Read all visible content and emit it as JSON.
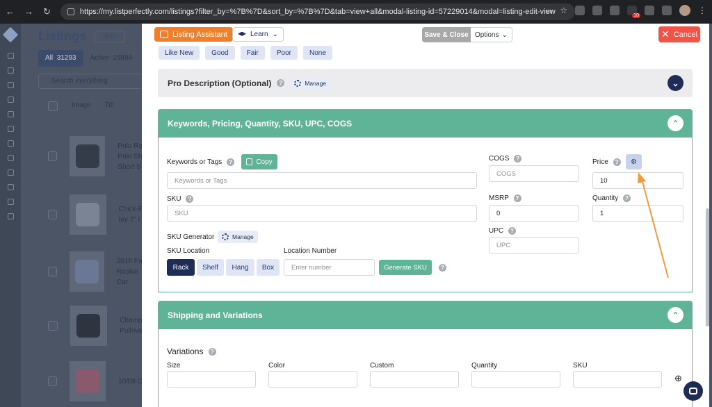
{
  "browser": {
    "url": "https://my.listperfectly.com/listings?filter_by=%7B%7D&sort_by=%7B%7D&tab=view+all&modal-listing-id=57229014&modal=listing-edit-view",
    "extension_badge": "10"
  },
  "background": {
    "title": "Listings",
    "learn_label": "Learn",
    "tabs": [
      {
        "label": "All",
        "count": "31293"
      },
      {
        "label": "Active",
        "count": "29894"
      }
    ],
    "search_placeholder": "Search everything",
    "columns": [
      "Image",
      "Titl"
    ],
    "rows": [
      {
        "title": "Polo Ra\nPolo Sh\nShort S"
      },
      {
        "title": "Chick-F\ntoy 7\" I"
      },
      {
        "title": "2018 Pa\nRookie\nCar"
      },
      {
        "title": "Champ\nPullove"
      },
      {
        "title": "10/09 C"
      }
    ]
  },
  "modal": {
    "assistant_label": "Listing Assistant",
    "learn_label": "Learn",
    "save_close_label": "Save & Close",
    "options_label": "Options",
    "cancel_label": "Cancel",
    "condition_chips": [
      "Like New",
      "Good",
      "Fair",
      "Poor",
      "None"
    ],
    "pro_description": {
      "title": "Pro Description (Optional)",
      "manage_label": "Manage"
    },
    "keywords_section": {
      "title": "Keywords, Pricing, Quantity, SKU, UPC, COGS",
      "keywords_label": "Keywords or Tags",
      "copy_label": "Copy",
      "keywords_placeholder": "Keywords or Tags",
      "sku_label": "SKU",
      "sku_placeholder": "SKU",
      "sku_generator_label": "SKU Generator",
      "sku_manage_label": "Manage",
      "sku_location_label": "SKU Location",
      "location_buttons": [
        "Rack",
        "Shelf",
        "Hang",
        "Box"
      ],
      "location_number_label": "Location Number",
      "location_number_placeholder": "Enter number",
      "generate_sku_label": "Generate SKU",
      "cogs_label": "COGS",
      "cogs_placeholder": "COGS",
      "msrp_label": "MSRP",
      "msrp_value": "0",
      "upc_label": "UPC",
      "upc_placeholder": "UPC",
      "price_label": "Price",
      "price_value": "10",
      "quantity_label": "Quantity",
      "quantity_value": "1"
    },
    "shipping_section": {
      "title": "Shipping and Variations",
      "variations_label": "Variations",
      "columns": [
        "Size",
        "Color",
        "Custom",
        "Quantity",
        "SKU"
      ]
    }
  },
  "colors": {
    "accent_green": "#5fb396",
    "navy": "#1f2d56",
    "orange": "#f07f2b",
    "cancel_red": "#ee5549",
    "annotation_arrow": "#f29a3c"
  }
}
